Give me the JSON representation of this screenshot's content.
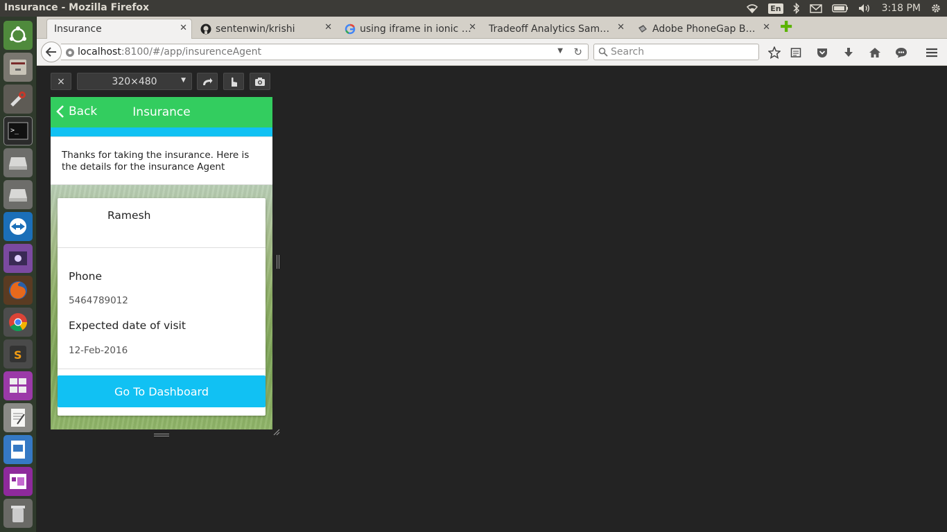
{
  "system": {
    "window_title": "Insurance - Mozilla Firefox",
    "keyboard_layout": "En",
    "time": "3:18 PM"
  },
  "browser": {
    "tabs": [
      {
        "label": "Insurance",
        "active": true
      },
      {
        "label": "sentenwin/krishi",
        "icon": "github-icon"
      },
      {
        "label": "using iframe in ionic …",
        "icon": "google-icon"
      },
      {
        "label": "Tradeoff Analytics Sam…"
      },
      {
        "label": "Adobe PhoneGap B…",
        "icon": "phonegap-icon"
      }
    ],
    "url_host": "localhost",
    "url_path": ":8100/#/app/insurenceAgent",
    "search_placeholder": "Search"
  },
  "rdm": {
    "close_label": "×",
    "size_label": "320×480"
  },
  "app": {
    "header": {
      "back_label": "Back",
      "title": "Insurance"
    },
    "message": "Thanks for taking the insurance. Here is the details for the insurance Agent",
    "agent": {
      "name": "Ramesh",
      "phone_label": "Phone",
      "phone_value": "5464789012",
      "visit_label": "Expected date of visit",
      "visit_value": "12-Feb-2016"
    },
    "dashboard_button": "Go To Dashboard"
  },
  "colors": {
    "header_green": "#33cd5f",
    "accent_blue": "#11c1f3"
  }
}
